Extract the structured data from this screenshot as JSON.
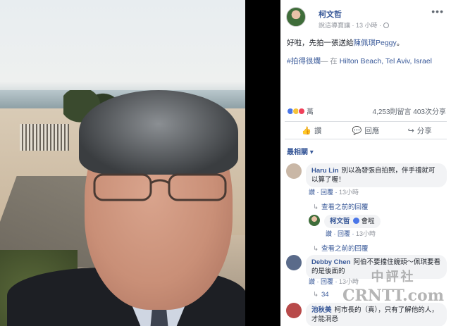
{
  "post": {
    "author": "柯文哲",
    "meta_text": "說這導寶讓 · 13 小時 ·",
    "text_before": "好啦，先拍一張送給",
    "text_mention": "陳佩琪Peggy",
    "text_after": "。",
    "hashtag": "#拍得很爛",
    "tag_mid": "— 在",
    "place": "Hilton Beach, Tel Aviv, Israel",
    "more_icon": "•••"
  },
  "reactions": {
    "count_label": "萬",
    "stats": "4,253則留言 403次分享"
  },
  "actions": [
    {
      "icon": "thumbs-up-icon",
      "glyph": "👍",
      "label": "讚"
    },
    {
      "icon": "comment-icon",
      "glyph": "💬",
      "label": "回應"
    },
    {
      "icon": "share-icon",
      "glyph": "↪",
      "label": "分享"
    }
  ],
  "sort_label": "最相關 ▾",
  "comments": [
    {
      "name": "Haru Lin",
      "text": "別以為發張自拍照，伴手禮就可以算了喔！",
      "like": "讚",
      "reply": "回覆",
      "time": "13小時",
      "view_prev": "查看之前的回覆",
      "avatar_color": "#c9b7a6"
    },
    {
      "name": "Debby Chen",
      "text": "阿伯不要擋住鏡頭～佩琪要看的是後面的",
      "like": "讚",
      "reply": "回覆",
      "time": "13小時",
      "view_prev_count": "34",
      "avatar_color": "#5a6b8a"
    },
    {
      "name": "池秋美",
      "text": "柯市長的（真），只有了解他的人，才能洞悉",
      "avatar_color": "#b84a4a"
    }
  ],
  "reply": {
    "name": "柯文哲",
    "text": "會啦",
    "like": "讚",
    "reply": "回覆",
    "time": "13小時",
    "view_prev": "查看之前的回覆"
  },
  "watermark": {
    "line1": "中評社",
    "line2": "CRNTT.com"
  }
}
